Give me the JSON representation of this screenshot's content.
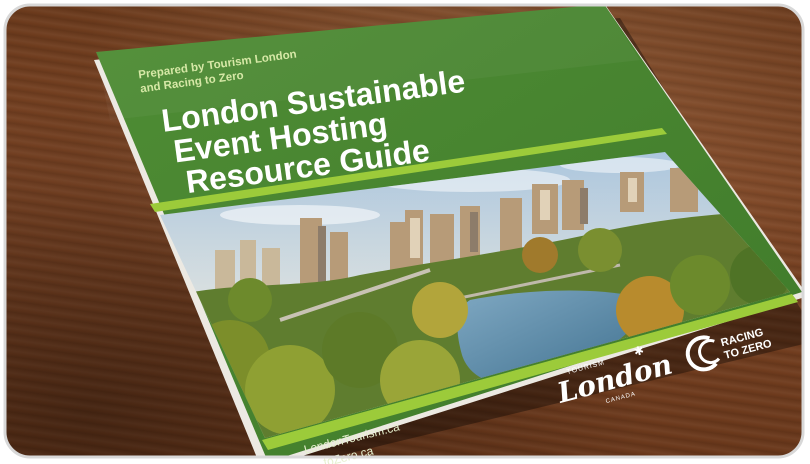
{
  "cover": {
    "prepared_by_line1": "Prepared by Tourism London",
    "prepared_by_line2": "and Racing to Zero",
    "title_line1": "London Sustainable",
    "title_line2": "Event Hosting",
    "title_line3": "Resource Guide",
    "url1": "LondonTourism.ca",
    "url2": "...toZero.ca",
    "tourism_logo_small": "TOURISM",
    "tourism_logo_main": "London",
    "tourism_logo_country": "CANADA",
    "racing_logo_line1": "RACING",
    "racing_logo_line2": "TO ZERO"
  },
  "colors": {
    "cover_green": "#4d8a33",
    "accent_lime": "#9ccb3a",
    "wood": "#7b4424"
  }
}
